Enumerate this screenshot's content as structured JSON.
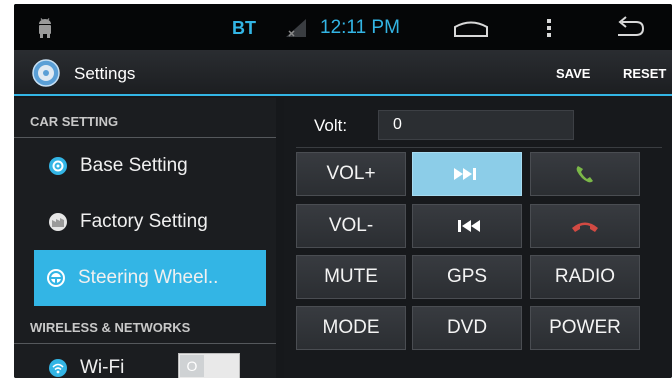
{
  "statusbar": {
    "bt_label": "BT",
    "time": "12:11 PM",
    "icons": [
      "android-debug-icon",
      "signal-icon",
      "home-icon",
      "menu-icon",
      "back-icon"
    ]
  },
  "actionbar": {
    "title": "Settings",
    "save_label": "SAVE",
    "reset_label": "RESET"
  },
  "sidebar": {
    "car_setting_header": "CAR SETTING",
    "items": [
      {
        "label": "Base Setting",
        "icon": "gear-icon",
        "active": false
      },
      {
        "label": "Factory Setting",
        "icon": "factory-icon",
        "active": false
      },
      {
        "label": "Steering Wheel..",
        "icon": "steering-wheel-icon",
        "active": true
      }
    ],
    "wireless_header": "WIRELESS & NETWORKS",
    "wifi": {
      "label": "Wi-Fi",
      "toggle_state": "O",
      "icon": "wifi-icon"
    }
  },
  "panel": {
    "volt_label": "Volt:",
    "volt_value": "0",
    "keys": [
      {
        "label": "VOL+"
      },
      {
        "label": "",
        "icon": "next-track-icon",
        "active": true
      },
      {
        "label": "",
        "icon": "call-answer-icon"
      },
      {
        "label": "VOL-"
      },
      {
        "label": "",
        "icon": "previous-track-icon"
      },
      {
        "label": "",
        "icon": "call-hangup-icon"
      },
      {
        "label": "MUTE"
      },
      {
        "label": "GPS"
      },
      {
        "label": "RADIO"
      },
      {
        "label": "MODE"
      },
      {
        "label": "DVD"
      },
      {
        "label": "POWER"
      }
    ]
  },
  "colors": {
    "accent": "#33b5e5",
    "active_key": "#8ccde8",
    "call_green": "#7bb848",
    "call_red": "#d24a43"
  }
}
